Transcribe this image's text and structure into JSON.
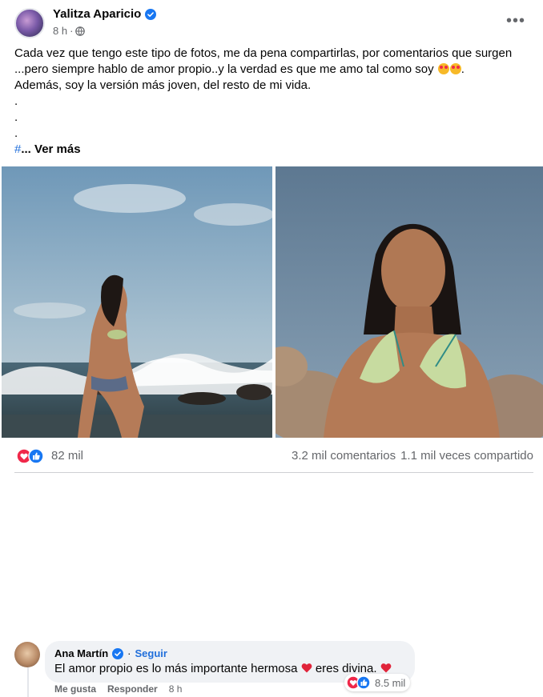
{
  "post": {
    "author": "Yalitza Aparicio",
    "time": "8 h",
    "separator": "·",
    "more_icon": "more-horizontal-icon",
    "text_lines": [
      "Cada vez que tengo este tipo de fotos, me da pena compartirlas, por comentarios que surgen",
      "...pero siempre hablo de amor propio..y la verdad es que me amo tal como soy",
      "Además, soy la versión más joven, del resto de mi vida.",
      ".",
      ".",
      "."
    ],
    "hashtag": "#",
    "see_more_prefix": "...",
    "see_more": "Ver más"
  },
  "stats": {
    "reactions_count": "82 mil",
    "comments": "3.2 mil comentarios",
    "shares": "1.1 mil veces compartido"
  },
  "comment": {
    "author": "Ana Martín",
    "follow": "Seguir",
    "text": "El amor propio es lo más importante hermosa",
    "text_2": "eres divina.",
    "reactions_count": "8.5 mil",
    "like": "Me gusta",
    "reply": "Responder",
    "time": "8 h"
  },
  "colors": {
    "accent": "#216fdb",
    "text_primary": "#050505",
    "text_secondary": "#65676b",
    "love": "#f0284a",
    "like": "#1877f2"
  }
}
